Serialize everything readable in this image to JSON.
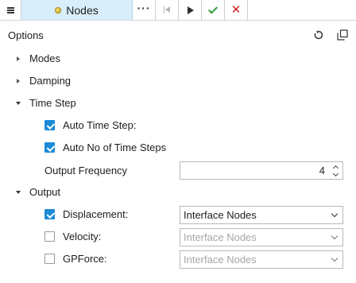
{
  "toolbar": {
    "menu_icon": "hamburger-icon",
    "nodes_label": "Nodes",
    "nodes_icon": "node-sphere-icon",
    "more_icon": "more-dots-icon",
    "start_icon": "skip-to-start-icon",
    "play_icon": "play-icon",
    "apply_icon": "check-icon",
    "cancel_icon": "close-icon",
    "accent_apply": "#2f9e36",
    "accent_cancel": "#d0231f",
    "active_tab_bg": "#d9eefb"
  },
  "panel": {
    "title": "Options",
    "reset_icon": "reset-icon",
    "popout_icon": "popout-icon"
  },
  "sections": {
    "modes": {
      "label": "Modes",
      "expanded": false
    },
    "damping": {
      "label": "Damping",
      "expanded": false
    },
    "time_step": {
      "label": "Time Step",
      "expanded": true,
      "auto_time_step": {
        "label": "Auto Time Step:",
        "checked": true
      },
      "auto_no_steps": {
        "label": "Auto No of Time Steps",
        "checked": true
      },
      "output_frequency": {
        "label": "Output Frequency",
        "value": "4"
      }
    },
    "output": {
      "label": "Output",
      "expanded": true,
      "displacement": {
        "label": "Displacement:",
        "checked": true,
        "value": "Interface Nodes",
        "enabled": true
      },
      "velocity": {
        "label": "Velocity:",
        "checked": false,
        "value": "Interface Nodes",
        "enabled": false
      },
      "gpforce": {
        "label": "GPForce:",
        "checked": false,
        "value": "Interface Nodes",
        "enabled": false
      }
    }
  },
  "colors": {
    "checkbox_checked": "#1c8ad8",
    "disabled_text": "#a6a6a6"
  }
}
